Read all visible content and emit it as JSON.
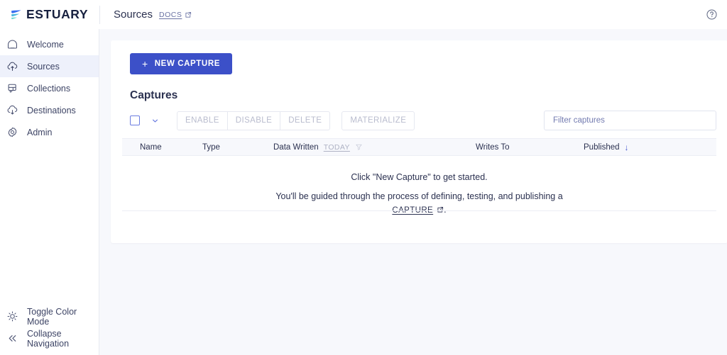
{
  "colors": {
    "accent": "#3c50c8",
    "page_bg": "#f7f8fc",
    "card_bg": "#ffffff",
    "text_dark": "#2b3150",
    "muted": "#b9bcce",
    "active_nav_bg": "#eef1fb",
    "logo_blue": "#3a6ff0",
    "logo_teal": "#6fd8d0"
  },
  "topbar": {
    "logo_text": "ESTUARY",
    "logo_icon": "estuary-wave-logo",
    "page_label": "Sources",
    "docs_label": "DOCS",
    "docs_icon": "external-link-icon",
    "help_icon": "help-circle-icon"
  },
  "sidebar": {
    "items": [
      {
        "label": "Welcome",
        "icon": "home-icon",
        "active": false
      },
      {
        "label": "Sources",
        "icon": "cloud-upload-icon",
        "active": true
      },
      {
        "label": "Collections",
        "icon": "collections-icon",
        "active": false
      },
      {
        "label": "Destinations",
        "icon": "cloud-download-icon",
        "active": false
      },
      {
        "label": "Admin",
        "icon": "gear-icon",
        "active": false
      }
    ],
    "bottom_items": [
      {
        "label": "Toggle Color Mode",
        "icon": "sun-icon"
      },
      {
        "label": "Collapse Navigation",
        "icon": "chevron-double-left-icon"
      }
    ]
  },
  "main": {
    "new_capture_label": "NEW CAPTURE",
    "new_capture_icon": "plus-icon",
    "section_title": "Captures",
    "toolbar": {
      "select_all_checkbox": "unchecked",
      "dropdown_icon": "chevron-down-icon",
      "buttons": [
        {
          "label": "ENABLE",
          "disabled": true
        },
        {
          "label": "DISABLE",
          "disabled": true
        },
        {
          "label": "DELETE",
          "disabled": true
        }
      ],
      "materialize_label": "MATERIALIZE",
      "materialize_disabled": true,
      "filter_placeholder": "Filter captures",
      "filter_value": ""
    },
    "table": {
      "columns": [
        {
          "label": "Name"
        },
        {
          "label": "Type"
        },
        {
          "label": "Data Written",
          "chip": "TODAY",
          "chip_icon": "funnel-filter-icon"
        },
        {
          "label": "Writes To"
        },
        {
          "label": "Published",
          "sort_icon": "arrow-down-icon"
        }
      ],
      "rows": []
    },
    "empty_state": {
      "line1": "Click \"New Capture\" to get started.",
      "line2_before": "You'll be guided through the process of defining, testing, and publishing a",
      "link_label": "CAPTURE",
      "link_icon": "external-link-icon",
      "line2_after": "."
    }
  }
}
